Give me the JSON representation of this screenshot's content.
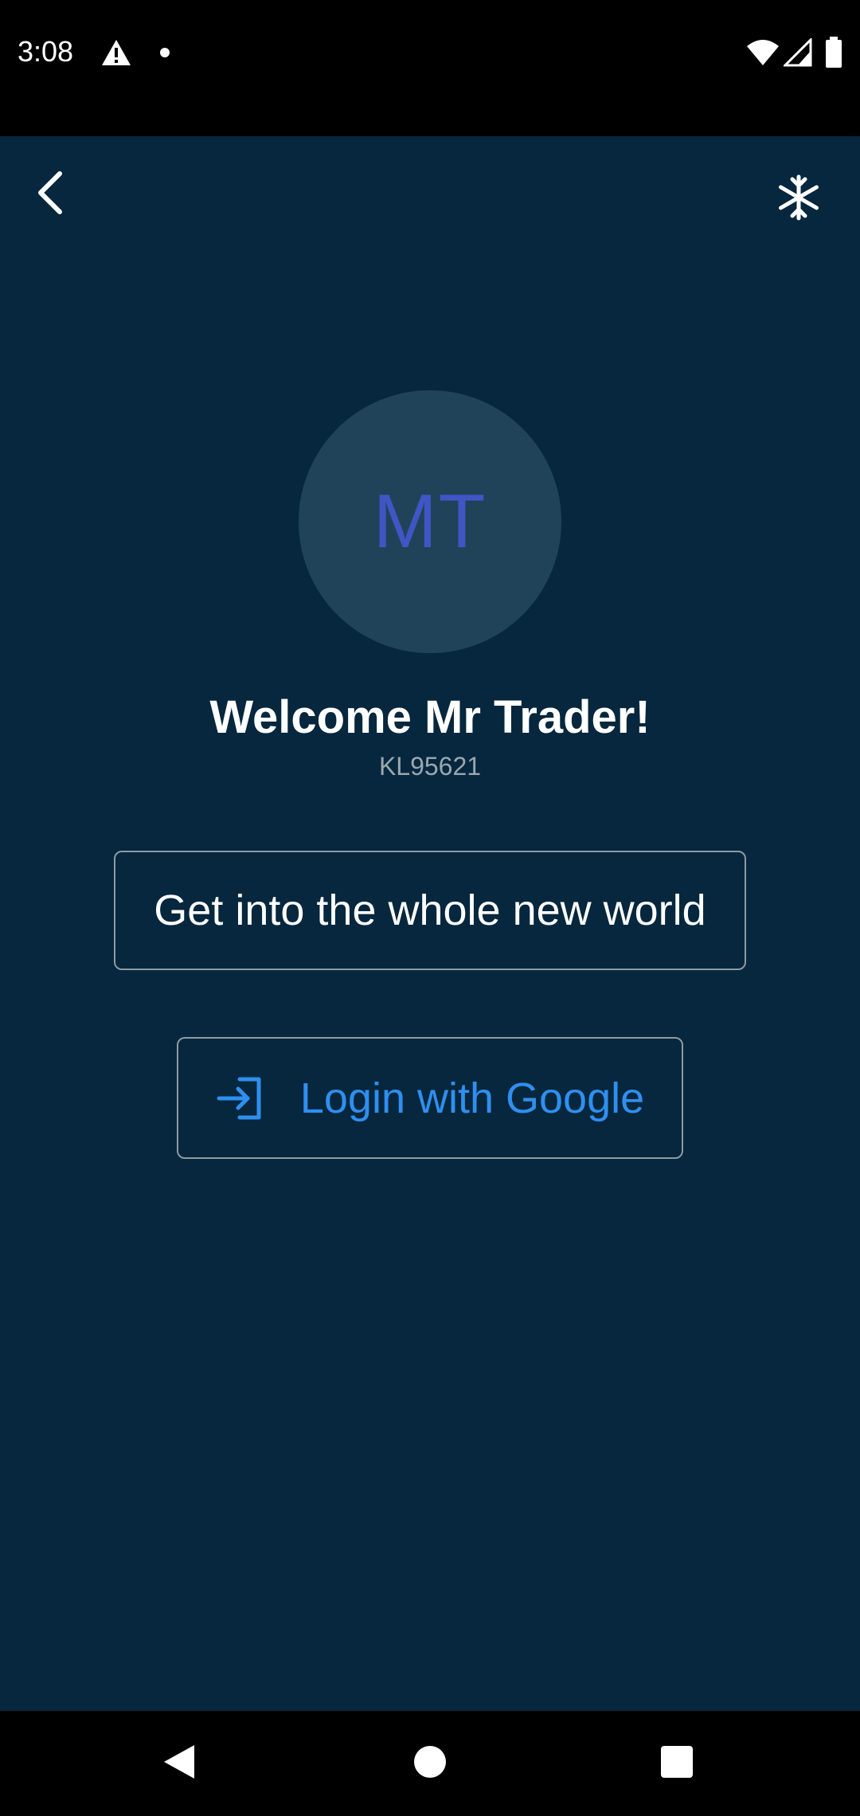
{
  "status_bar": {
    "time": "3:08",
    "icons": [
      "warning-icon",
      "notification-dot-icon",
      "wifi-icon",
      "signal-icon",
      "battery-icon"
    ]
  },
  "toolbar": {
    "back_icon": "chevron-left-icon",
    "theme_icon": "snowflake-icon"
  },
  "profile": {
    "initials": "MT",
    "welcome": "Welcome Mr Trader!",
    "user_id": "KL95621"
  },
  "actions": {
    "explore_label": "Get into the whole new world",
    "google_login_label": "Login with Google",
    "google_login_icon": "login-arrow-icon"
  },
  "navigation": {
    "icons": [
      "nav-back-icon",
      "nav-home-icon",
      "nav-recents-icon"
    ]
  },
  "colors": {
    "background": "#06273d",
    "avatar_bg": "#21435a",
    "avatar_text": "#3f56c4",
    "accent": "#2f8ff0",
    "subtext": "#9aa7b0"
  }
}
